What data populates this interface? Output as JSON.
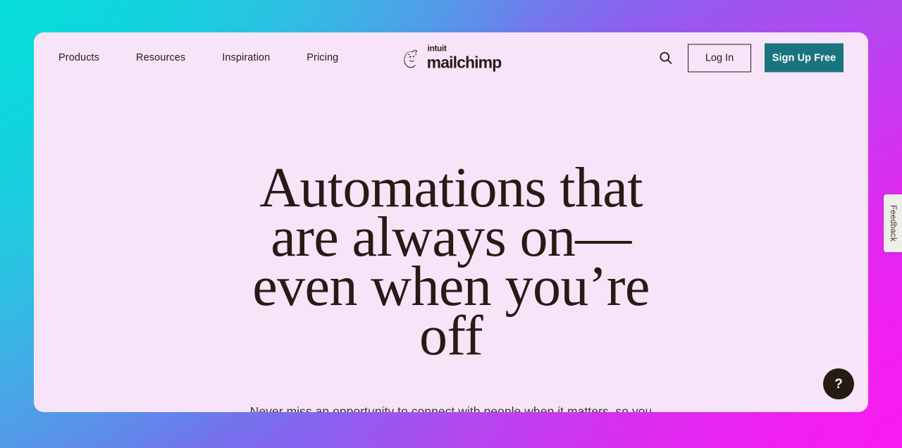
{
  "header": {
    "nav": [
      {
        "label": "Products"
      },
      {
        "label": "Resources"
      },
      {
        "label": "Inspiration"
      },
      {
        "label": "Pricing"
      }
    ],
    "logo": {
      "mark": "mailchimp-freddie-icon",
      "intuit": "intuit",
      "mailchimp": "mailchimp"
    },
    "search_icon": "search-icon",
    "login_label": "Log In",
    "signup_label": "Sign Up Free"
  },
  "hero": {
    "headline": "Automations that are always on— even when you’re off",
    "subhead": "Never miss an opportunity to connect with people when it matters, so you can turn shoppers into loyal customers."
  },
  "widgets": {
    "feedback_label": "Feedback",
    "help_label": "?"
  },
  "colors": {
    "card_background": "#F8E4F8",
    "text_primary": "#241C15",
    "accent_teal": "#1A7480",
    "gradient_cyan": "#11D2DC",
    "gradient_violet": "#7B6BEE",
    "gradient_magenta": "#E020EE",
    "feedback_tab": "#EFEFE9"
  }
}
